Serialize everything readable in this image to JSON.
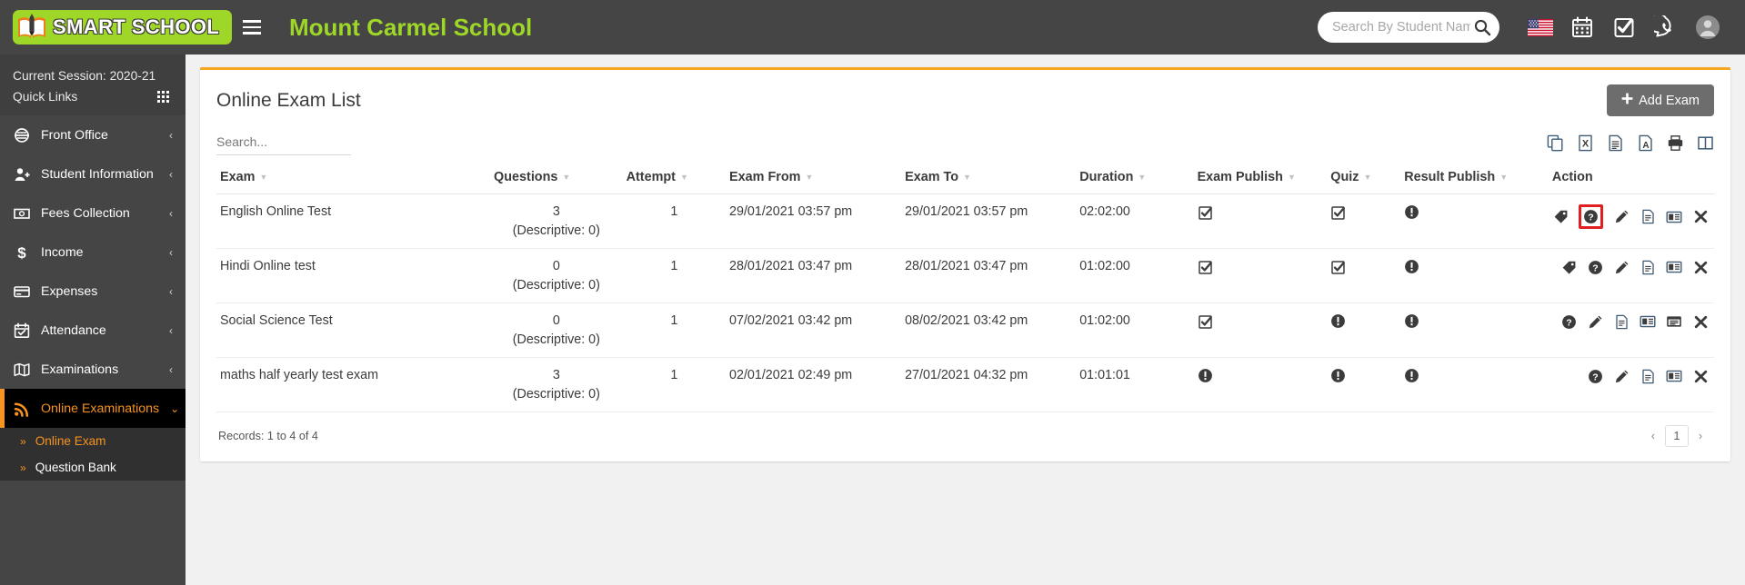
{
  "topbar": {
    "logo_text": "SMART SCHOOL",
    "logo_icon": "book-pen-icon",
    "menu_icon": "hamburger-icon",
    "school_name": "Mount Carmel School",
    "search": {
      "placeholder": "Search By Student Name",
      "value": "",
      "icon": "search-icon"
    },
    "icons": [
      {
        "name": "language-flag-icon",
        "label": "US"
      },
      {
        "name": "calendar-icon",
        "label": "Calendar"
      },
      {
        "name": "task-check-icon",
        "label": "Tasks"
      },
      {
        "name": "whatsapp-icon",
        "label": "WhatsApp"
      },
      {
        "name": "user-avatar-icon",
        "label": "Profile"
      }
    ]
  },
  "sidebar": {
    "session_label": "Current Session: 2020-21",
    "quick_links_label": "Quick Links",
    "quick_links_icon": "grid-icon",
    "items": [
      {
        "label": "Front Office",
        "icon": "front-office-icon",
        "caret": "‹",
        "active": false
      },
      {
        "label": "Student Information",
        "icon": "student-add-icon",
        "caret": "‹",
        "active": false
      },
      {
        "label": "Fees Collection",
        "icon": "money-note-icon",
        "caret": "‹",
        "active": false
      },
      {
        "label": "Income",
        "icon": "dollar-icon",
        "caret": "‹",
        "active": false
      },
      {
        "label": "Expenses",
        "icon": "card-icon",
        "caret": "‹",
        "active": false
      },
      {
        "label": "Attendance",
        "icon": "calendar-check-icon",
        "caret": "‹",
        "active": false
      },
      {
        "label": "Examinations",
        "icon": "book-open-icon",
        "caret": "‹",
        "active": false
      },
      {
        "label": "Online Examinations",
        "icon": "rss-signal-icon",
        "caret": "⌄",
        "active": true
      }
    ],
    "submenu": [
      {
        "label": "Online Exam",
        "active": true
      },
      {
        "label": "Question Bank",
        "active": false
      }
    ]
  },
  "main": {
    "title": "Online Exam List",
    "add_button": {
      "label": "Add Exam",
      "icon": "plus-icon"
    },
    "table_search": {
      "placeholder": "Search...",
      "value": ""
    },
    "export_buttons": [
      {
        "name": "copy-icon",
        "label": "Copy"
      },
      {
        "name": "excel-icon",
        "label": "Excel"
      },
      {
        "name": "csv-icon",
        "label": "CSV"
      },
      {
        "name": "pdf-icon",
        "label": "PDF"
      },
      {
        "name": "print-icon",
        "label": "Print"
      },
      {
        "name": "column-visibility-icon",
        "label": "Column visibility"
      }
    ],
    "columns": [
      "Exam",
      "Questions",
      "Attempt",
      "Exam From",
      "Exam To",
      "Duration",
      "Exam Publish",
      "Quiz",
      "Result Publish",
      "Action"
    ],
    "rows": [
      {
        "exam": "English Online Test",
        "questions": "3",
        "descriptive": "(Descriptive: 0)",
        "attempt": "1",
        "exam_from": "29/01/2021 03:57 pm",
        "exam_to": "29/01/2021 03:57 pm",
        "duration": "02:02:00",
        "exam_publish": "check",
        "quiz": "check",
        "result_publish": "info",
        "actions": [
          "tag-icon",
          "question-mark-icon",
          "edit-pencil-icon",
          "document-icon",
          "result-card-icon",
          "delete-x-icon"
        ],
        "highlighted_action": "question-mark-icon"
      },
      {
        "exam": "Hindi Online test",
        "questions": "0",
        "descriptive": "(Descriptive: 0)",
        "attempt": "1",
        "exam_from": "28/01/2021 03:47 pm",
        "exam_to": "28/01/2021 03:47 pm",
        "duration": "01:02:00",
        "exam_publish": "check",
        "quiz": "check",
        "result_publish": "info",
        "actions": [
          "tag-icon",
          "question-mark-icon",
          "edit-pencil-icon",
          "document-icon",
          "result-card-icon",
          "delete-x-icon"
        ],
        "highlighted_action": ""
      },
      {
        "exam": "Social Science Test",
        "questions": "0",
        "descriptive": "(Descriptive: 0)",
        "attempt": "1",
        "exam_from": "07/02/2021 03:42 pm",
        "exam_to": "08/02/2021 03:42 pm",
        "duration": "01:02:00",
        "exam_publish": "check",
        "quiz": "info",
        "result_publish": "info",
        "actions": [
          "question-mark-icon",
          "edit-pencil-icon",
          "document-icon",
          "result-card-icon",
          "window-list-icon",
          "delete-x-icon"
        ],
        "highlighted_action": ""
      },
      {
        "exam": "maths half yearly test exam",
        "questions": "3",
        "descriptive": "(Descriptive: 0)",
        "attempt": "1",
        "exam_from": "02/01/2021 02:49 pm",
        "exam_to": "27/01/2021 04:32 pm",
        "duration": "01:01:01",
        "exam_publish": "info",
        "quiz": "info",
        "result_publish": "info",
        "actions": [
          "question-mark-icon",
          "edit-pencil-icon",
          "document-icon",
          "result-card-icon",
          "delete-x-icon"
        ],
        "highlighted_action": ""
      }
    ],
    "records_text": "Records: 1 to 4 of 4",
    "pager": {
      "prev": "‹",
      "page": "1",
      "next": "›"
    }
  },
  "colors": {
    "brand_green": "#9fd728",
    "accent_orange": "#f7931e",
    "card_top": "#f5a623",
    "sidebar_bg": "#454545",
    "highlight_red": "#e02020"
  }
}
